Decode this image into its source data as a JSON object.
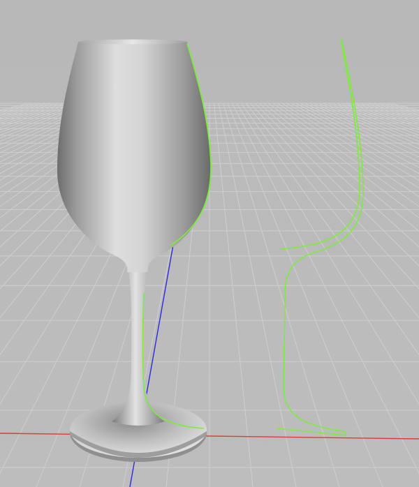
{
  "viewport": {
    "view": "perspective",
    "background_color": "#b9b9b9",
    "grid_color": "#cfcfcf",
    "grid_visible": true,
    "axis_x_color": "#e03a3a",
    "axis_z_color": "#2a2ae0",
    "spline_color": "#7cec3a",
    "mesh_color": "#c8c8c8"
  },
  "objects": [
    {
      "name": "wine-glass",
      "type": "lathe-mesh",
      "selected": false
    },
    {
      "name": "profile-spline",
      "type": "spline",
      "selected": true
    }
  ]
}
